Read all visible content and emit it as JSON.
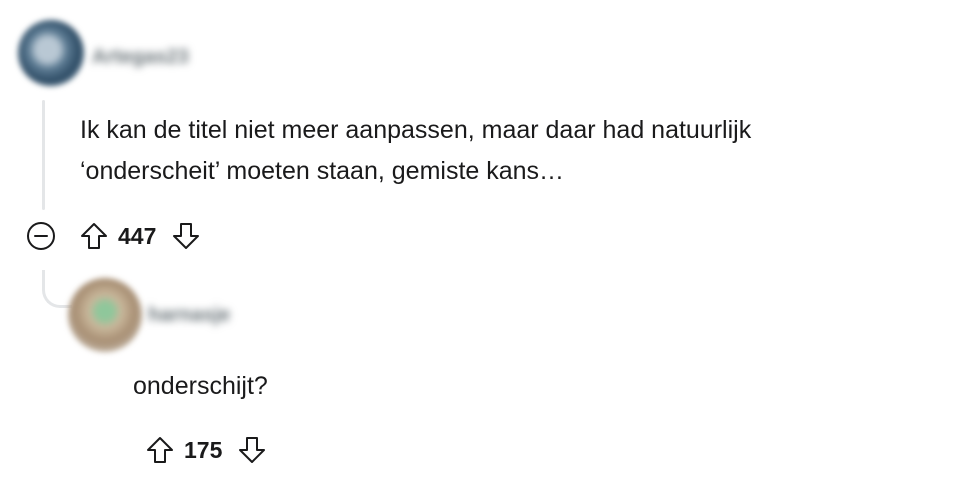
{
  "thread": {
    "op_comment": {
      "author": "Artegas23",
      "body_lines": [
        "Ik kan de titel niet meer aanpassen, maar daar had natuurlijk",
        "‘onderscheit’ moeten staan, gemiste kans…"
      ],
      "score": "447",
      "icons": {
        "collapse": "collapse-minus-icon",
        "upvote": "upvote-arrow-icon",
        "downvote": "downvote-arrow-icon"
      }
    },
    "reply_comment": {
      "author": "harnasje",
      "body": "onderschijt?",
      "score": "175",
      "icons": {
        "upvote": "upvote-arrow-icon",
        "downvote": "downvote-arrow-icon"
      }
    }
  },
  "colors": {
    "text": "#1a1a1b",
    "thread_line": "#e4e6e8",
    "icon_stroke": "#1a1a1b"
  }
}
